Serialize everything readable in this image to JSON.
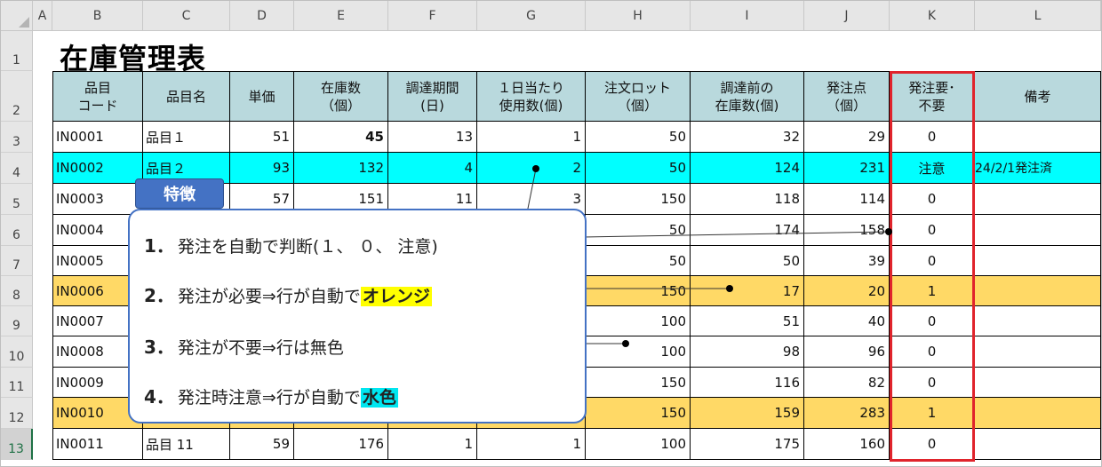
{
  "columns": [
    "A",
    "B",
    "C",
    "D",
    "E",
    "F",
    "G",
    "H",
    "I",
    "J",
    "K",
    "L"
  ],
  "rows": [
    "1",
    "2",
    "3",
    "4",
    "5",
    "6",
    "7",
    "8",
    "9",
    "10",
    "11",
    "12",
    "13"
  ],
  "title": "在庫管理表",
  "headers": {
    "code": "品目\nコード",
    "name": "品目名",
    "price": "単価",
    "stock": "在庫数\n（個）",
    "period": "調達期間\n(日)",
    "daily": "１日当たり\n使用数(個)",
    "lot": "注文ロット\n（個）",
    "pre": "調達前の\n在庫数(個)",
    "point": "発注点\n（個）",
    "need": "発注要･\n不要",
    "memo": "備考"
  },
  "data_rows": [
    {
      "code": "IN0001",
      "name": "品目１",
      "price": "51",
      "stock": "45",
      "period": "13",
      "daily": "1",
      "lot": "50",
      "pre": "32",
      "point": "29",
      "need": "0",
      "memo": ""
    },
    {
      "code": "IN0002",
      "name": "品目２",
      "price": "93",
      "stock": "132",
      "period": "4",
      "daily": "2",
      "lot": "50",
      "pre": "124",
      "point": "231",
      "need": "注意",
      "memo": "24/2/1発注済"
    },
    {
      "code": "IN0003",
      "name": "",
      "price": "57",
      "stock": "151",
      "period": "11",
      "daily": "3",
      "lot": "150",
      "pre": "118",
      "point": "114",
      "need": "0",
      "memo": ""
    },
    {
      "code": "IN0004",
      "name": "",
      "price": "",
      "stock": "",
      "period": "",
      "daily": "",
      "lot": "50",
      "pre": "174",
      "point": "158",
      "need": "0",
      "memo": ""
    },
    {
      "code": "IN0005",
      "name": "",
      "price": "",
      "stock": "",
      "period": "",
      "daily": "",
      "lot": "50",
      "pre": "50",
      "point": "39",
      "need": "0",
      "memo": ""
    },
    {
      "code": "IN0006",
      "name": "",
      "price": "",
      "stock": "",
      "period": "",
      "daily": "",
      "lot": "150",
      "pre": "17",
      "point": "20",
      "need": "1",
      "memo": ""
    },
    {
      "code": "IN0007",
      "name": "",
      "price": "",
      "stock": "",
      "period": "",
      "daily": "",
      "lot": "100",
      "pre": "51",
      "point": "40",
      "need": "0",
      "memo": ""
    },
    {
      "code": "IN0008",
      "name": "",
      "price": "",
      "stock": "",
      "period": "",
      "daily": "",
      "lot": "100",
      "pre": "98",
      "point": "96",
      "need": "0",
      "memo": ""
    },
    {
      "code": "IN0009",
      "name": "",
      "price": "",
      "stock": "",
      "period": "",
      "daily": "",
      "lot": "150",
      "pre": "116",
      "point": "82",
      "need": "0",
      "memo": ""
    },
    {
      "code": "IN0010",
      "name": "",
      "price": "",
      "stock": "",
      "period": "",
      "daily": "",
      "lot": "150",
      "pre": "159",
      "point": "283",
      "need": "1",
      "memo": ""
    },
    {
      "code": "IN0011",
      "name": "品目 11",
      "price": "59",
      "stock": "176",
      "period": "1",
      "daily": "1",
      "lot": "100",
      "pre": "175",
      "point": "160",
      "need": "0",
      "memo": ""
    }
  ],
  "row_highlight": [
    "none",
    "cyan",
    "none",
    "none",
    "none",
    "orange",
    "none",
    "none",
    "none",
    "orange",
    "none"
  ],
  "callout": {
    "tag": "特徴",
    "items": [
      {
        "num": "1．",
        "text": "発注を自動で判断(１、 ０、 注意)",
        "hl": ""
      },
      {
        "num": "2．",
        "text": "発注が必要⇒行が自動で",
        "hl": "オレンジ"
      },
      {
        "num": "3．",
        "text": "発注が不要⇒行は無色",
        "hl": ""
      },
      {
        "num": "4．",
        "text": "発注時注意⇒行が自動で",
        "hl": "水色"
      }
    ]
  },
  "colors": {
    "header_fill": "#b9d9dd",
    "orange_row": "#ffd966",
    "cyan_row": "#00ffff",
    "red_frame": "#e0242c",
    "callout_border": "#4472c4"
  }
}
